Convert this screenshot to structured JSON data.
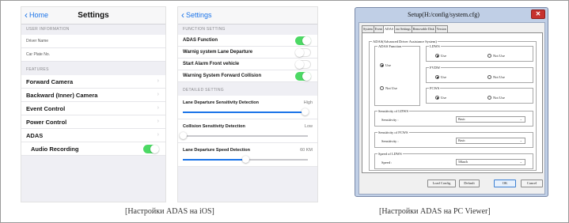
{
  "ios_settings": {
    "back_label": "Home",
    "title": "Settings",
    "user_info_header": "User information",
    "driver_name_label": "Driver Name",
    "driver_name_placeholder": "",
    "car_plate_label": "Car Plate No.",
    "car_plate_placeholder": "",
    "features_header": "Features",
    "features": [
      {
        "label": "Forward Camera",
        "type": "link"
      },
      {
        "label": "Backward (Inner) Camera",
        "type": "link"
      },
      {
        "label": "Event Control",
        "type": "link"
      },
      {
        "label": "Power Control",
        "type": "link"
      },
      {
        "label": "ADAS",
        "type": "link"
      }
    ],
    "audio_recording": {
      "label": "Audio Recording",
      "on": true
    }
  },
  "ios_adas": {
    "back_label": "Settings",
    "function_header": "Function setting",
    "functions": [
      {
        "label": "ADAS Function",
        "on": true
      },
      {
        "label": "Warnig system Lane Departure",
        "on": false
      },
      {
        "label": "Start Alarm Front vehicle",
        "on": false
      },
      {
        "label": "Warning System Forward Collision",
        "on": true
      }
    ],
    "detail_header": "Detailed setting",
    "sliders": [
      {
        "label": "Lane Departure Sensitivity Detection",
        "value_text": "High",
        "level": 0.98
      },
      {
        "label": "Collision Sensitivity Detection",
        "value_text": "Low",
        "level": 0.0
      },
      {
        "label": "Lane Departure Speed Detection",
        "value_text": "60 KM",
        "level": 0.5
      }
    ]
  },
  "pc_viewer": {
    "title": "Setup(H:/config/system.cfg)",
    "close_glyph": "✕",
    "tabs": [
      {
        "label": "System",
        "active": false
      },
      {
        "label": "Event",
        "active": false
      },
      {
        "label": "ADAS",
        "active": true
      },
      {
        "label": "ear Settings",
        "active": false
      },
      {
        "label": "Removable Disk",
        "active": false
      },
      {
        "label": "Version",
        "active": false
      }
    ],
    "adas_group_title": "ADAS(Advanced Driver Assistance System)",
    "function_group_title": "ADAS Function",
    "function_use": "Use",
    "function_not_use": "Not Use",
    "ldws_title": "LDWS",
    "fvdw_title": "FVDW",
    "fcws_title": "FCWS",
    "use_label": "Use",
    "not_use_label": "Not Use",
    "ldws_sens_title": "Sensitivity of LDWS",
    "ldws_sens_label": "Sensitivity :",
    "ldws_sens_value": "Basic",
    "fcws_sens_title": "Sensitivity of FCWS",
    "fcws_sens_label": "Sensitivity :",
    "fcws_sens_value": "Basic",
    "speed_title": "Speed of LDWS",
    "speed_label": "Speed :",
    "speed_value": "50km/h",
    "dropdown_glyph": "⌄",
    "buttons": {
      "load": "Load Config",
      "default": "Default",
      "ok": "OK",
      "cancel": "Cancel"
    }
  },
  "captions": {
    "ios": "[Настройки ADAS на iOS]",
    "pc": "[Настройки ADAS на PC Viewer]"
  },
  "colors": {
    "ios_accent": "#1a73e8",
    "toggle_on": "#4cd964",
    "close_red": "#c7322e"
  }
}
